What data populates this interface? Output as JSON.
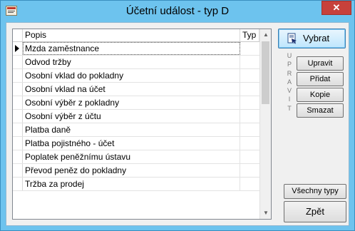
{
  "window": {
    "title": "Účetní událost - typ D",
    "close": "✕"
  },
  "grid": {
    "columns": [
      "Popis",
      "Typ"
    ],
    "rows": [
      "Mzda zaměstnance",
      "Odvod tržby",
      "Osobní vklad do pokladny",
      "Osobní vklad na účet",
      "Osobní výběr z pokladny",
      "Osobní výběr z účtu",
      "Platba daně",
      "Platba pojistného - účet",
      "Poplatek peněžnímu ústavu",
      "Převod peněz do pokladny",
      "Tržba za prodej"
    ],
    "selected_index": 0
  },
  "buttons": {
    "vybrat": "Vybrat",
    "upravit": "Upravit",
    "pridat": "Přidat",
    "kopie": "Kopie",
    "smazat": "Smazat",
    "vsechny_typy": "Všechny typy",
    "zpet": "Zpět"
  },
  "side_label": [
    "U",
    "P",
    "R",
    "A",
    "V",
    "I",
    "T"
  ],
  "icons": {
    "app": "app-icon",
    "select": "document-select-icon",
    "row_pointer": "row-pointer-icon",
    "scroll_up": "scroll-up-arrow-icon",
    "scroll_down": "scroll-down-arrow-icon"
  },
  "colors": {
    "title_bar": "#6dc3ee",
    "close": "#c7413b",
    "default_button": "#bee6fd"
  }
}
